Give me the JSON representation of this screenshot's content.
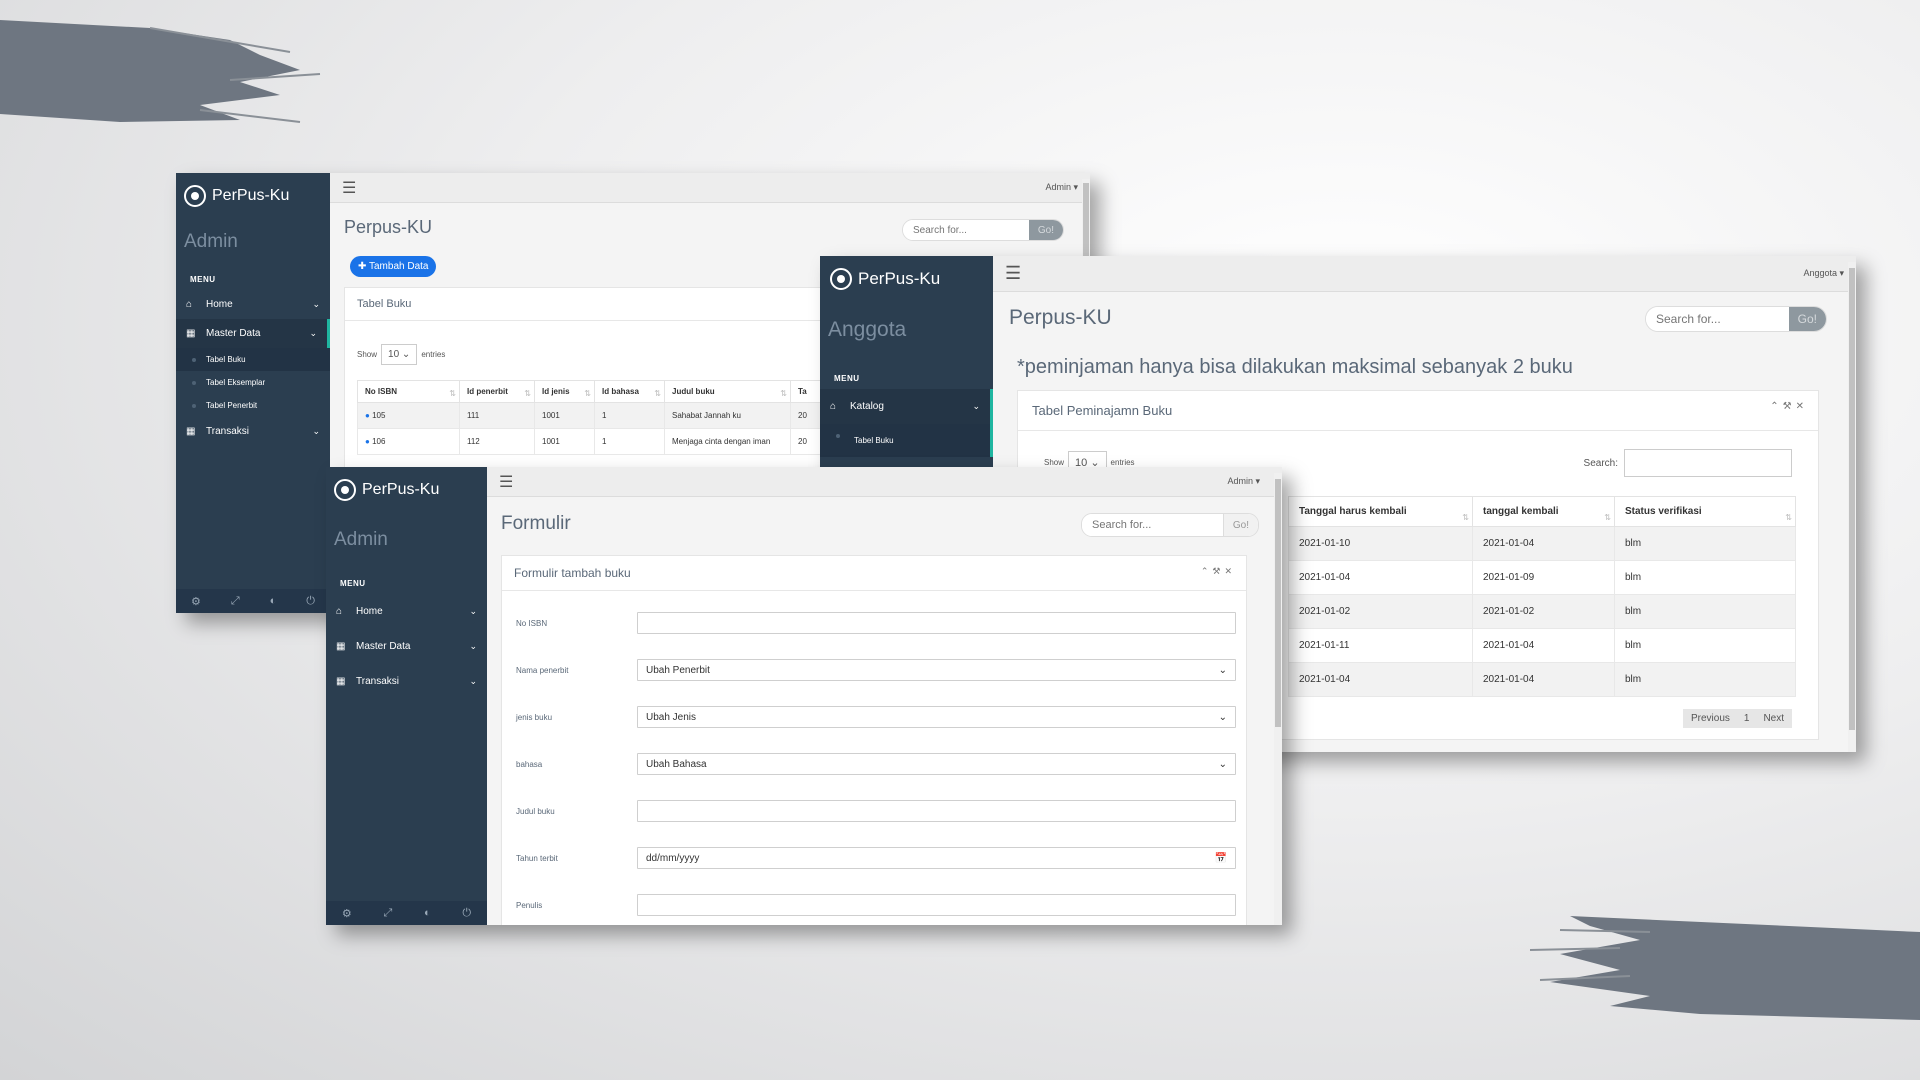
{
  "colors": {
    "sidebar": "#2b3e50",
    "accent": "#1fb5a0",
    "primary_button": "#1a73e8",
    "brush": "#6e7681"
  },
  "window_admin_table": {
    "brand": "PerPus-Ku",
    "role": "Admin",
    "menu_header": "MENU",
    "menu": [
      {
        "label": "Home",
        "icon": "home-icon"
      },
      {
        "label": "Master Data",
        "icon": "table-icon"
      },
      {
        "label": "Transaksi",
        "icon": "table-icon"
      }
    ],
    "submenu": [
      "Tabel Buku",
      "Tabel Eksemplar",
      "Tabel Penerbit"
    ],
    "user": "Admin",
    "title": "Perpus-KU",
    "search_placeholder": "Search for...",
    "go": "Go!",
    "add_button": "Tambah Data",
    "panel_title": "Tabel Buku",
    "show": "Show",
    "entries_value": "10",
    "entries": "entries",
    "columns": [
      "No ISBN",
      "Id penerbit",
      "Id jenis",
      "Id bahasa",
      "Judul buku",
      "Ta"
    ],
    "rows": [
      [
        "105",
        "111",
        "1001",
        "1",
        "Sahabat Jannah ku",
        "20"
      ],
      [
        "106",
        "112",
        "1001",
        "1",
        "Menjaga cinta dengan iman",
        "20"
      ]
    ]
  },
  "window_anggota": {
    "brand": "PerPus-Ku",
    "role": "Anggota",
    "menu_header": "MENU",
    "menu_item": "Katalog",
    "submenu_item": "Tabel Buku",
    "user": "Anggota",
    "title": "Perpus-KU",
    "search_placeholder": "Search for...",
    "go": "Go!",
    "notice": "*peminjaman hanya bisa dilakukan maksimal sebanyak 2 buku",
    "panel_title": "Tabel Peminajamn Buku",
    "search_label": "Search:",
    "show": "Show",
    "entries_value": "10",
    "entries": "entries",
    "columns": [
      "Tanggal harus kembali",
      "tanggal kembali",
      "Status verifikasi"
    ],
    "rows": [
      [
        "2021-01-10",
        "2021-01-04",
        "blm"
      ],
      [
        "2021-01-04",
        "2021-01-09",
        "blm"
      ],
      [
        "2021-01-02",
        "2021-01-02",
        "blm"
      ],
      [
        "2021-01-11",
        "2021-01-04",
        "blm"
      ],
      [
        "2021-01-04",
        "2021-01-04",
        "blm"
      ]
    ],
    "pagination": {
      "previous": "Previous",
      "page": "1",
      "next": "Next"
    }
  },
  "window_form": {
    "brand": "PerPus-Ku",
    "role": "Admin",
    "menu_header": "MENU",
    "menu": [
      {
        "label": "Home",
        "icon": "home-icon"
      },
      {
        "label": "Master Data",
        "icon": "table-icon"
      },
      {
        "label": "Transaksi",
        "icon": "table-icon"
      }
    ],
    "user": "Admin",
    "title": "Formulir",
    "search_placeholder": "Search for...",
    "go": "Go!",
    "panel_title": "Formulir tambah buku",
    "fields": [
      {
        "label": "No ISBN",
        "type": "text",
        "value": ""
      },
      {
        "label": "Nama penerbit",
        "type": "select",
        "value": "Ubah Penerbit"
      },
      {
        "label": "jenis buku",
        "type": "select",
        "value": "Ubah Jenis"
      },
      {
        "label": "bahasa",
        "type": "select",
        "value": "Ubah Bahasa"
      },
      {
        "label": "Judul buku",
        "type": "text",
        "value": ""
      },
      {
        "label": "Tahun terbit",
        "type": "date",
        "value": "dd/mm/yyyy"
      },
      {
        "label": "Penulis",
        "type": "text",
        "value": ""
      }
    ]
  }
}
